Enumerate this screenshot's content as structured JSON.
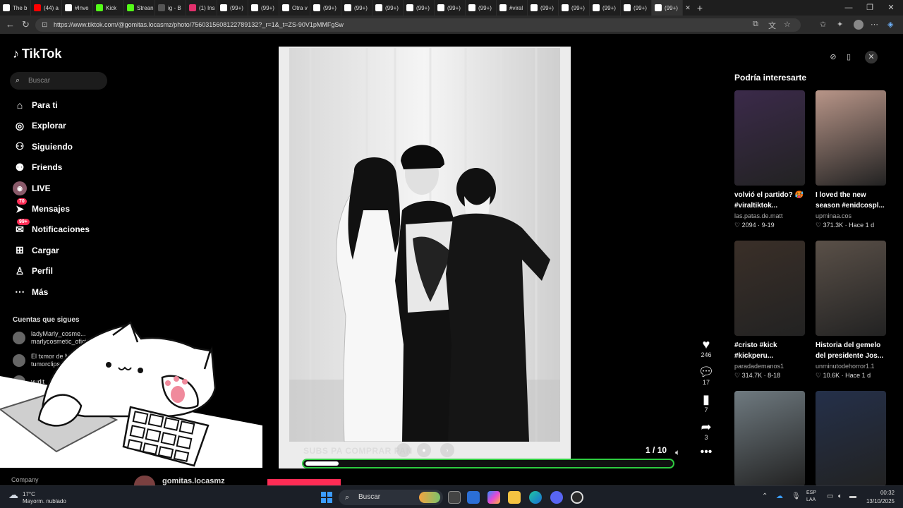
{
  "browser": {
    "tabs": [
      {
        "label": "The b",
        "color": "#ffffff"
      },
      {
        "label": "(44) a",
        "color": "#ff0000"
      },
      {
        "label": "#Inve",
        "color": "#ffffff"
      },
      {
        "label": "Kick",
        "color": "#53fc18"
      },
      {
        "label": "Strean",
        "color": "#53fc18"
      },
      {
        "label": "ig - B",
        "color": "#555555"
      },
      {
        "label": "(1) Ins",
        "color": "#e1306c"
      },
      {
        "label": "(99+)",
        "color": "#ffffff"
      },
      {
        "label": "(99+)",
        "color": "#ffffff"
      },
      {
        "label": "Otra v",
        "color": "#ffffff"
      },
      {
        "label": "(99+)",
        "color": "#ffffff"
      },
      {
        "label": "(99+)",
        "color": "#ffffff"
      },
      {
        "label": "(99+)",
        "color": "#ffffff"
      },
      {
        "label": "(99+)",
        "color": "#ffffff"
      },
      {
        "label": "(99+)",
        "color": "#ffffff"
      },
      {
        "label": "(99+)",
        "color": "#ffffff"
      },
      {
        "label": "#viral",
        "color": "#ffffff"
      },
      {
        "label": "(99+)",
        "color": "#ffffff"
      },
      {
        "label": "(99+)",
        "color": "#ffffff"
      },
      {
        "label": "(99+)",
        "color": "#ffffff"
      },
      {
        "label": "(99+)",
        "color": "#ffffff"
      },
      {
        "label": "(99+)",
        "color": "#ffffff"
      }
    ],
    "url": "https://www.tiktok.com/@gomitas.locasmz/photo/7560315608122789132?_r=1&_t=ZS-90V1pMMFgSw"
  },
  "sidebar": {
    "logo": "TikTok",
    "search_placeholder": "Buscar",
    "items": [
      {
        "label": "Para ti",
        "icon": "home-icon"
      },
      {
        "label": "Explorar",
        "icon": "compass-icon"
      },
      {
        "label": "Siguiendo",
        "icon": "following-icon"
      },
      {
        "label": "Friends",
        "icon": "friends-icon"
      },
      {
        "label": "LIVE",
        "icon": "live-icon"
      },
      {
        "label": "Mensajes",
        "icon": "messages-icon",
        "badge": "70"
      },
      {
        "label": "Notificaciones",
        "icon": "notifications-icon",
        "badge": "99+"
      },
      {
        "label": "Cargar",
        "icon": "upload-icon"
      },
      {
        "label": "Perfil",
        "icon": "profile-icon"
      },
      {
        "label": "Más",
        "icon": "more-icon"
      }
    ],
    "following_heading": "Cuentas que sigues",
    "following": [
      {
        "name": "ladyMarly_cosme...",
        "sub": "marlycosmetic_ofici"
      },
      {
        "name": "El txmor de M",
        "sub": "tumorclips"
      },
      {
        "name": "yudit",
        "sub": ""
      }
    ],
    "company": "Company"
  },
  "post": {
    "caption_overlay": "SUBS PA COMPRAR PAN",
    "counter_current": "1",
    "counter_total": "/ 10",
    "progress": 0.09,
    "username": "gomitas.locasmz",
    "actions": {
      "likes": "246",
      "comments": "17",
      "saves": "7",
      "shares": "3"
    }
  },
  "recommendations": {
    "title": "Podría interesarte",
    "items": [
      {
        "title": "volvió el partido? 🥵",
        "title2": "#viraltiktok...",
        "user": "las.patas.de.matt",
        "likes": "2094",
        "date": "9-19",
        "thumb": "#3b2a4a"
      },
      {
        "title": "I loved the new",
        "title2": "season #enidcospl...",
        "user": "upminaa.cos",
        "likes": "371.3K",
        "date": "Hace 1 d",
        "thumb": "#b89588"
      },
      {
        "title": "#cristo #kick",
        "title2": "#kickperu...",
        "user": "paradademanos1",
        "likes": "314.7K",
        "date": "8-18",
        "thumb": "#3a2f28"
      },
      {
        "title": "Historia del gemelo",
        "title2": "del presidente Jos...",
        "user": "unminutodehorror1.1",
        "likes": "10.6K",
        "date": "Hace 1 d",
        "thumb": "#5a5048"
      },
      {
        "title": "",
        "title2": "",
        "user": "",
        "likes": "",
        "date": "",
        "thumb": "#6f7a80"
      },
      {
        "title": "",
        "title2": "",
        "user": "",
        "likes": "",
        "date": "",
        "thumb": "#24304a"
      }
    ]
  },
  "taskbar": {
    "weather_temp": "17°C",
    "weather_desc": "Mayorm. nublado",
    "search": "Buscar",
    "lang1": "ESP",
    "lang2": "LAA",
    "time": "00:32",
    "date": "13/10/2025"
  }
}
